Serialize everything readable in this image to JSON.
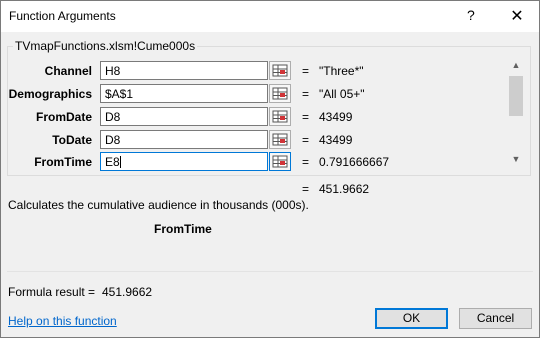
{
  "window": {
    "title": "Function Arguments",
    "help_symbol": "?",
    "close_symbol": "✕"
  },
  "group": {
    "label": "TVmapFunctions.xlsm!Cume000s"
  },
  "arguments": [
    {
      "label": "Channel",
      "input": "H8",
      "eq": "=",
      "value": "\"Three*\""
    },
    {
      "label": "Demographics",
      "input": "$A$1",
      "eq": "=",
      "value": "\"All 05+\""
    },
    {
      "label": "FromDate",
      "input": "D8",
      "eq": "=",
      "value": "43499"
    },
    {
      "label": "ToDate",
      "input": "D8",
      "eq": "=",
      "value": "43499"
    },
    {
      "label": "FromTime",
      "input": "E8",
      "eq": "=",
      "value": "0.791666667"
    }
  ],
  "function_result": {
    "eq": "=",
    "value": "451.9662"
  },
  "description": "Calculates the cumulative audience in thousands (000s).",
  "argument_description": "FromTime",
  "formula": {
    "label": "Formula result =",
    "value": "451.9662"
  },
  "help_link": "Help on this function",
  "buttons": {
    "ok": "OK",
    "cancel": "Cancel"
  },
  "scroll": {
    "up": "▲",
    "down": "▼"
  }
}
